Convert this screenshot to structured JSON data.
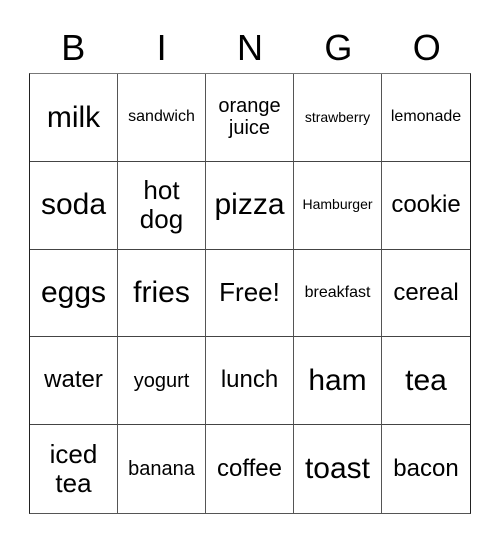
{
  "header": {
    "letters": [
      "B",
      "I",
      "N",
      "G",
      "O"
    ]
  },
  "board": {
    "rows": [
      [
        "milk",
        "sandwich",
        "orange juice",
        "strawberry",
        "lemonade"
      ],
      [
        "soda",
        "hot dog",
        "pizza",
        "Hamburger",
        "cookie"
      ],
      [
        "eggs",
        "fries",
        "Free!",
        "breakfast",
        "cereal"
      ],
      [
        "water",
        "yogurt",
        "lunch",
        "ham",
        "tea"
      ],
      [
        "iced tea",
        "banana",
        "coffee",
        "toast",
        "bacon"
      ]
    ],
    "free_space": "Free!"
  },
  "colors": {
    "background": "#ffffff",
    "text": "#000000",
    "grid_line": "#555555"
  }
}
